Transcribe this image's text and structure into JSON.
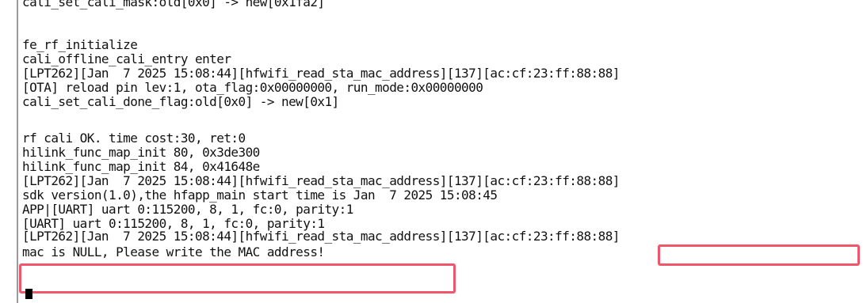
{
  "log": {
    "lines": [
      "cali_set_cali_mask:old[0x0] -> new[0x1fa2]",
      "",
      "fe_rf_initialize",
      "cali_offline_cali_entry enter",
      "[LPT262][Jan  7 2025 15:08:44][hfwifi_read_sta_mac_address][137][ac:cf:23:ff:88:88]",
      "[OTA] reload pin lev:1, ota_flag:0x00000000, run_mode:0x00000000",
      "cali_set_cali_done_flag:old[0x0] -> new[0x1]",
      "",
      "rf cali OK. time cost:30, ret:0",
      "hilink_func_map_init 80, 0x3de300",
      "hilink_func_map_init 84, 0x41648e",
      "[LPT262][Jan  7 2025 15:08:44][hfwifi_read_sta_mac_address][137][ac:cf:23:ff:88:88]",
      "sdk version(1.0),the hfapp_main start time is Jan  7 2025 15:08:45",
      "APP|[UART] uart 0:115200, 8, 1, fc:0, parity:1",
      "[UART] uart 0:115200, 8, 1, fc:0, parity:1",
      "[LPT262][Jan  7 2025 15:08:44][hfwifi_read_sta_mac_address][137][ac:cf:23:ff:88:88]",
      "mac is NULL, Please write the MAC address!"
    ]
  },
  "colors": {
    "highlight": "#f0566a",
    "text": "#111111",
    "background": "#ffffff"
  }
}
